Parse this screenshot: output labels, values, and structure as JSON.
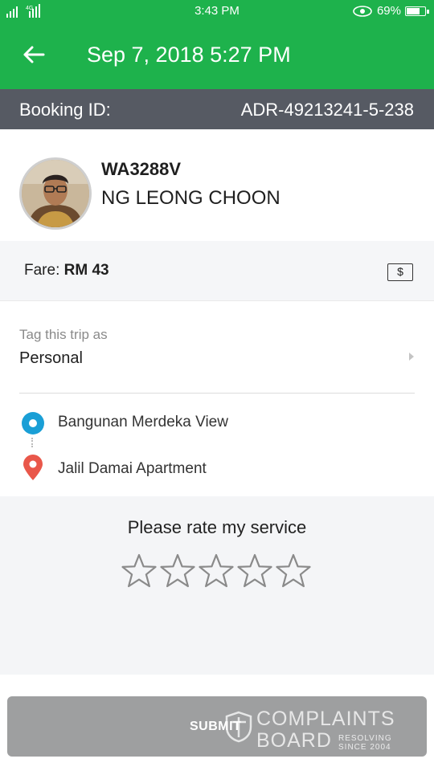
{
  "status_bar": {
    "network": "4G",
    "time": "3:43 PM",
    "battery": "69%"
  },
  "header": {
    "title": "Sep 7, 2018 5:27 PM",
    "back_icon": "arrow-left-icon"
  },
  "booking": {
    "label": "Booking ID:",
    "id": "ADR-49213241-5-238"
  },
  "driver": {
    "plate": "WA3288V",
    "name": "NG LEONG CHOON"
  },
  "fare": {
    "label": "Fare:",
    "amount": "RM 43",
    "icon": "cash-icon",
    "icon_glyph": "$"
  },
  "tag": {
    "label": "Tag this trip as",
    "value": "Personal"
  },
  "route": {
    "pickup": "Bangunan Merdeka View",
    "dropoff": "Jalil Damai Apartment"
  },
  "rating": {
    "prompt": "Please rate my service",
    "max_stars": 5,
    "selected": 0
  },
  "submit": {
    "label": "SUBMIT"
  },
  "watermark": {
    "line1": "COMPLAINTS",
    "line2": "BOARD",
    "tagline1": "RESOLVING",
    "tagline2": "SINCE 2004"
  },
  "colors": {
    "brand": "#1eb24c",
    "booking_bar": "#565a63",
    "pickup": "#1a9fd6",
    "dropoff": "#e9574a",
    "submit_disabled": "#9e9fa0"
  }
}
